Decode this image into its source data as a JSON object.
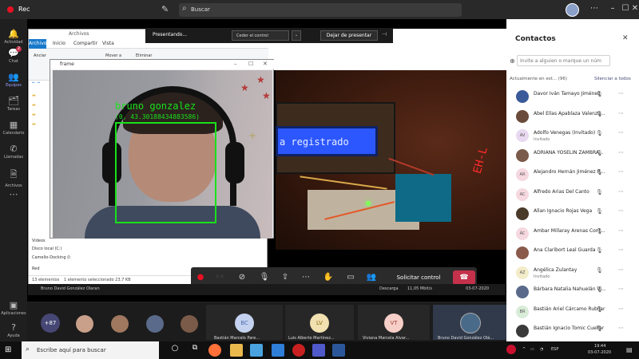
{
  "teams": {
    "rec_label": "Rec",
    "search_placeholder": "Buscar",
    "rail": [
      {
        "label": "Actividad",
        "icon": "bell-icon"
      },
      {
        "label": "Chat",
        "icon": "chat-icon",
        "badge": "2"
      },
      {
        "label": "Equipos",
        "icon": "teams-icon"
      },
      {
        "label": "Tareas",
        "icon": "tasks-icon"
      },
      {
        "label": "Calendario",
        "icon": "calendar-icon"
      },
      {
        "label": "Llamadas",
        "icon": "phone-icon"
      },
      {
        "label": "Archivos",
        "icon": "files-icon"
      },
      {
        "label": "Aplicaciones",
        "icon": "apps-icon"
      },
      {
        "label": "Ayuda",
        "icon": "help-icon"
      }
    ]
  },
  "presenting": {
    "label": "Presentando...",
    "give_control": "Ceder el control",
    "stop": "Dejar de presentar"
  },
  "explorer": {
    "title": "Archivos",
    "tabs": [
      "Archivo",
      "Inicio",
      "Compartir",
      "Vista"
    ],
    "ribbon_buttons": [
      "Anclar",
      "Mover a",
      "Eliminar"
    ],
    "tree": [
      "Videos",
      "Disco local (C:)",
      "Camello-Docking (I:",
      "Red"
    ],
    "status_items": "13 elementos",
    "status_selected": "1 elemento seleccionado  23,7 KB"
  },
  "frame_window": {
    "title": "frame",
    "detected_name": "bruno gonzalez",
    "detected_coords": "(0, 43.30188434883586)"
  },
  "shared_photo": {
    "lcd_text": "a registrado",
    "seven_segment": "EH-L"
  },
  "controls": {
    "request_control": "Solicitar control"
  },
  "share_taskbar": {
    "owner": "Bruno David González Olaran",
    "download": "Descarga",
    "speed": "11,05 Mbit/s",
    "date": "03-07-2020"
  },
  "participants": {
    "overflow": "+87",
    "tiles": [
      {
        "initials": "BC",
        "name": "Bastián Marcelo Pare...",
        "color": "#c4d2f0",
        "fg": "#4f6bb0"
      },
      {
        "initials": "LV",
        "name": "Luis Alberto Martínez...",
        "color": "#f1e0b0",
        "fg": "#8a6a14"
      },
      {
        "initials": "VT",
        "name": "Viviana Marcela Alvar...",
        "color": "#f6cfc8",
        "fg": "#a8463a"
      },
      {
        "initials": "",
        "name": "Bruno David González Olá...",
        "color": "#4a6a8a",
        "fg": "#fff"
      }
    ]
  },
  "contacts": {
    "title": "Contactos",
    "invite_placeholder": "Invite a alguien o marque un núm",
    "section": "Actualmente en est...  (96)",
    "mute_all": "Silenciar a todos",
    "list": [
      {
        "name": "Davor Iván Tamayo Jiménez",
        "sub": "",
        "initials": "",
        "color": "#3b5a9a"
      },
      {
        "name": "Abel Elías Apablaza Valenzu...",
        "sub": "",
        "initials": "",
        "color": "#6a4a3a"
      },
      {
        "name": "Adolfo Venegas (Invitado)",
        "sub": "Invitado",
        "initials": "AV",
        "color": "#e8d8f0"
      },
      {
        "name": "ADRIANA YOSELIN ZAMBRA...",
        "sub": "",
        "initials": "",
        "color": "#7a5a4a"
      },
      {
        "name": "Alejandro Hernán Jiménez R...",
        "sub": "",
        "initials": "AR",
        "color": "#f6d8e0"
      },
      {
        "name": "Alfredo Arias Del Canto",
        "sub": "",
        "initials": "AC",
        "color": "#f6d8e0"
      },
      {
        "name": "Allan Ignacio Rojas Vega",
        "sub": "",
        "initials": "",
        "color": "#4a3a2a"
      },
      {
        "name": "Ámbar Millaray Arenas Cont...",
        "sub": "",
        "initials": "ÁC",
        "color": "#f6d8e0"
      },
      {
        "name": "Ana Claribort Leal Guarda",
        "sub": "",
        "initials": "",
        "color": "#8a5a4a"
      },
      {
        "name": "Angélica Zulantay",
        "sub": "Invitado",
        "initials": "AZ",
        "color": "#f3ecc8"
      },
      {
        "name": "Bárbara Natalia Nahuelán Vi...",
        "sub": "",
        "initials": "",
        "color": "#5a6a8a"
      },
      {
        "name": "Bastián Ariel Cárcamo Rubilar",
        "sub": "",
        "initials": "BR",
        "color": "#d8ecd8"
      },
      {
        "name": "Bastián Ignacio Tomic Cuellar",
        "sub": "",
        "initials": "",
        "color": "#3a3a3a"
      }
    ]
  },
  "taskbar": {
    "search_placeholder": "Escribe aquí para buscar",
    "time": "19:44",
    "date": "03-07-2020",
    "lang": "ESP"
  }
}
